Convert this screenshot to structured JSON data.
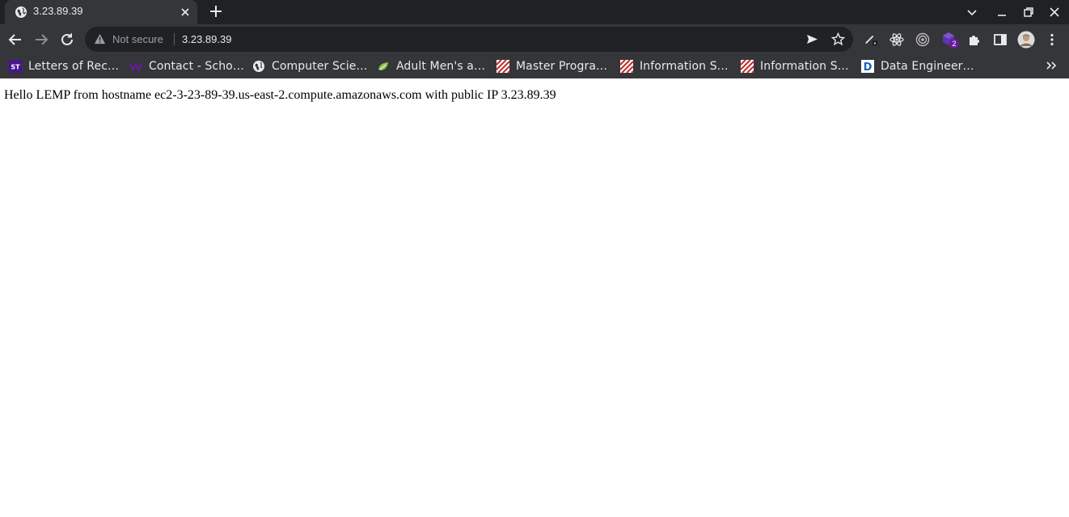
{
  "tab": {
    "title": "3.23.89.39"
  },
  "omnibox": {
    "security_label": "Not secure",
    "url": "3.23.89.39"
  },
  "bookmarks": [
    {
      "label": "Letters of Rec…",
      "icon": "st-logo-icon"
    },
    {
      "label": "Contact - Scho…",
      "icon": "w-logo-icon"
    },
    {
      "label": "Computer Scie…",
      "icon": "globe-icon"
    },
    {
      "label": "Adult Men's a…",
      "icon": "leaf-logo-icon"
    },
    {
      "label": "Master Progra…",
      "icon": "striped-logo-icon"
    },
    {
      "label": "Information S…",
      "icon": "striped-logo-icon"
    },
    {
      "label": "Information S…",
      "icon": "striped-logo-icon"
    },
    {
      "label": "Data Engineer…",
      "icon": "d-logo-icon"
    }
  ],
  "extensions": {
    "badge_count": "2"
  },
  "page": {
    "body_text": "Hello LEMP from hostname ec2-3-23-89-39.us-east-2.compute.amazonaws.com with public IP 3.23.89.39"
  },
  "colors": {
    "titlebar": "#202124",
    "toolbar": "#35363a",
    "text": "#e8eaed",
    "muted": "#9aa0a6",
    "badge": "#6a1b9a"
  }
}
